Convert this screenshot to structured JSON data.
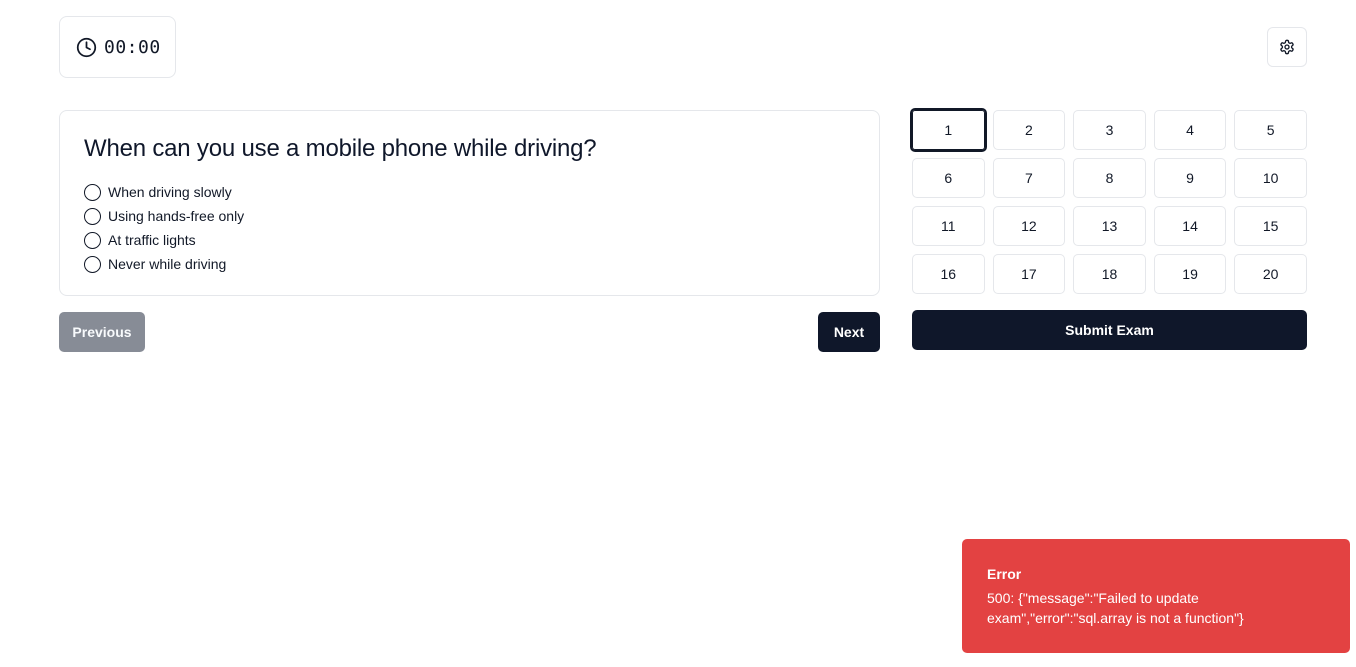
{
  "timer": {
    "value": "00:00",
    "icon": "clock-icon"
  },
  "settings": {
    "icon": "gear-icon"
  },
  "question": {
    "title": "When can you use a mobile phone while driving?",
    "options": [
      {
        "label": "When driving slowly"
      },
      {
        "label": "Using hands-free only"
      },
      {
        "label": "At traffic lights"
      },
      {
        "label": "Never while driving"
      }
    ]
  },
  "navigation": {
    "previous_label": "Previous",
    "next_label": "Next"
  },
  "question_grid": {
    "current": 1,
    "numbers": [
      "1",
      "2",
      "3",
      "4",
      "5",
      "6",
      "7",
      "8",
      "9",
      "10",
      "11",
      "12",
      "13",
      "14",
      "15",
      "16",
      "17",
      "18",
      "19",
      "20"
    ]
  },
  "submit_label": "Submit Exam",
  "toast": {
    "title": "Error",
    "message": "500: {\"message\":\"Failed to update exam\",\"error\":\"sql.array is not a function\"}",
    "color": "#e34242"
  }
}
